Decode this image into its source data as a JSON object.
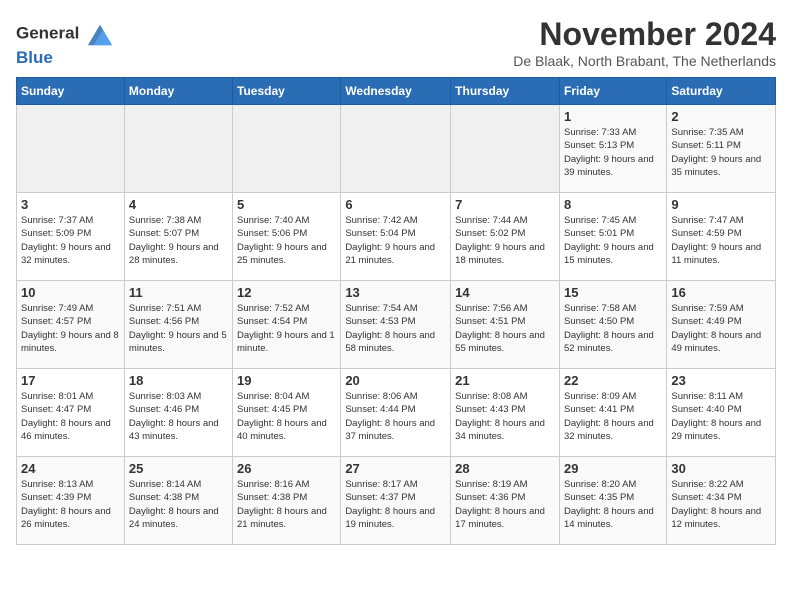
{
  "header": {
    "logo_line1": "General",
    "logo_line2": "Blue",
    "month_title": "November 2024",
    "location": "De Blaak, North Brabant, The Netherlands"
  },
  "columns": [
    "Sunday",
    "Monday",
    "Tuesday",
    "Wednesday",
    "Thursday",
    "Friday",
    "Saturday"
  ],
  "weeks": [
    [
      {
        "day": "",
        "info": ""
      },
      {
        "day": "",
        "info": ""
      },
      {
        "day": "",
        "info": ""
      },
      {
        "day": "",
        "info": ""
      },
      {
        "day": "",
        "info": ""
      },
      {
        "day": "1",
        "info": "Sunrise: 7:33 AM\nSunset: 5:13 PM\nDaylight: 9 hours and 39 minutes."
      },
      {
        "day": "2",
        "info": "Sunrise: 7:35 AM\nSunset: 5:11 PM\nDaylight: 9 hours and 35 minutes."
      }
    ],
    [
      {
        "day": "3",
        "info": "Sunrise: 7:37 AM\nSunset: 5:09 PM\nDaylight: 9 hours and 32 minutes."
      },
      {
        "day": "4",
        "info": "Sunrise: 7:38 AM\nSunset: 5:07 PM\nDaylight: 9 hours and 28 minutes."
      },
      {
        "day": "5",
        "info": "Sunrise: 7:40 AM\nSunset: 5:06 PM\nDaylight: 9 hours and 25 minutes."
      },
      {
        "day": "6",
        "info": "Sunrise: 7:42 AM\nSunset: 5:04 PM\nDaylight: 9 hours and 21 minutes."
      },
      {
        "day": "7",
        "info": "Sunrise: 7:44 AM\nSunset: 5:02 PM\nDaylight: 9 hours and 18 minutes."
      },
      {
        "day": "8",
        "info": "Sunrise: 7:45 AM\nSunset: 5:01 PM\nDaylight: 9 hours and 15 minutes."
      },
      {
        "day": "9",
        "info": "Sunrise: 7:47 AM\nSunset: 4:59 PM\nDaylight: 9 hours and 11 minutes."
      }
    ],
    [
      {
        "day": "10",
        "info": "Sunrise: 7:49 AM\nSunset: 4:57 PM\nDaylight: 9 hours and 8 minutes."
      },
      {
        "day": "11",
        "info": "Sunrise: 7:51 AM\nSunset: 4:56 PM\nDaylight: 9 hours and 5 minutes."
      },
      {
        "day": "12",
        "info": "Sunrise: 7:52 AM\nSunset: 4:54 PM\nDaylight: 9 hours and 1 minute."
      },
      {
        "day": "13",
        "info": "Sunrise: 7:54 AM\nSunset: 4:53 PM\nDaylight: 8 hours and 58 minutes."
      },
      {
        "day": "14",
        "info": "Sunrise: 7:56 AM\nSunset: 4:51 PM\nDaylight: 8 hours and 55 minutes."
      },
      {
        "day": "15",
        "info": "Sunrise: 7:58 AM\nSunset: 4:50 PM\nDaylight: 8 hours and 52 minutes."
      },
      {
        "day": "16",
        "info": "Sunrise: 7:59 AM\nSunset: 4:49 PM\nDaylight: 8 hours and 49 minutes."
      }
    ],
    [
      {
        "day": "17",
        "info": "Sunrise: 8:01 AM\nSunset: 4:47 PM\nDaylight: 8 hours and 46 minutes."
      },
      {
        "day": "18",
        "info": "Sunrise: 8:03 AM\nSunset: 4:46 PM\nDaylight: 8 hours and 43 minutes."
      },
      {
        "day": "19",
        "info": "Sunrise: 8:04 AM\nSunset: 4:45 PM\nDaylight: 8 hours and 40 minutes."
      },
      {
        "day": "20",
        "info": "Sunrise: 8:06 AM\nSunset: 4:44 PM\nDaylight: 8 hours and 37 minutes."
      },
      {
        "day": "21",
        "info": "Sunrise: 8:08 AM\nSunset: 4:43 PM\nDaylight: 8 hours and 34 minutes."
      },
      {
        "day": "22",
        "info": "Sunrise: 8:09 AM\nSunset: 4:41 PM\nDaylight: 8 hours and 32 minutes."
      },
      {
        "day": "23",
        "info": "Sunrise: 8:11 AM\nSunset: 4:40 PM\nDaylight: 8 hours and 29 minutes."
      }
    ],
    [
      {
        "day": "24",
        "info": "Sunrise: 8:13 AM\nSunset: 4:39 PM\nDaylight: 8 hours and 26 minutes."
      },
      {
        "day": "25",
        "info": "Sunrise: 8:14 AM\nSunset: 4:38 PM\nDaylight: 8 hours and 24 minutes."
      },
      {
        "day": "26",
        "info": "Sunrise: 8:16 AM\nSunset: 4:38 PM\nDaylight: 8 hours and 21 minutes."
      },
      {
        "day": "27",
        "info": "Sunrise: 8:17 AM\nSunset: 4:37 PM\nDaylight: 8 hours and 19 minutes."
      },
      {
        "day": "28",
        "info": "Sunrise: 8:19 AM\nSunset: 4:36 PM\nDaylight: 8 hours and 17 minutes."
      },
      {
        "day": "29",
        "info": "Sunrise: 8:20 AM\nSunset: 4:35 PM\nDaylight: 8 hours and 14 minutes."
      },
      {
        "day": "30",
        "info": "Sunrise: 8:22 AM\nSunset: 4:34 PM\nDaylight: 8 hours and 12 minutes."
      }
    ]
  ]
}
